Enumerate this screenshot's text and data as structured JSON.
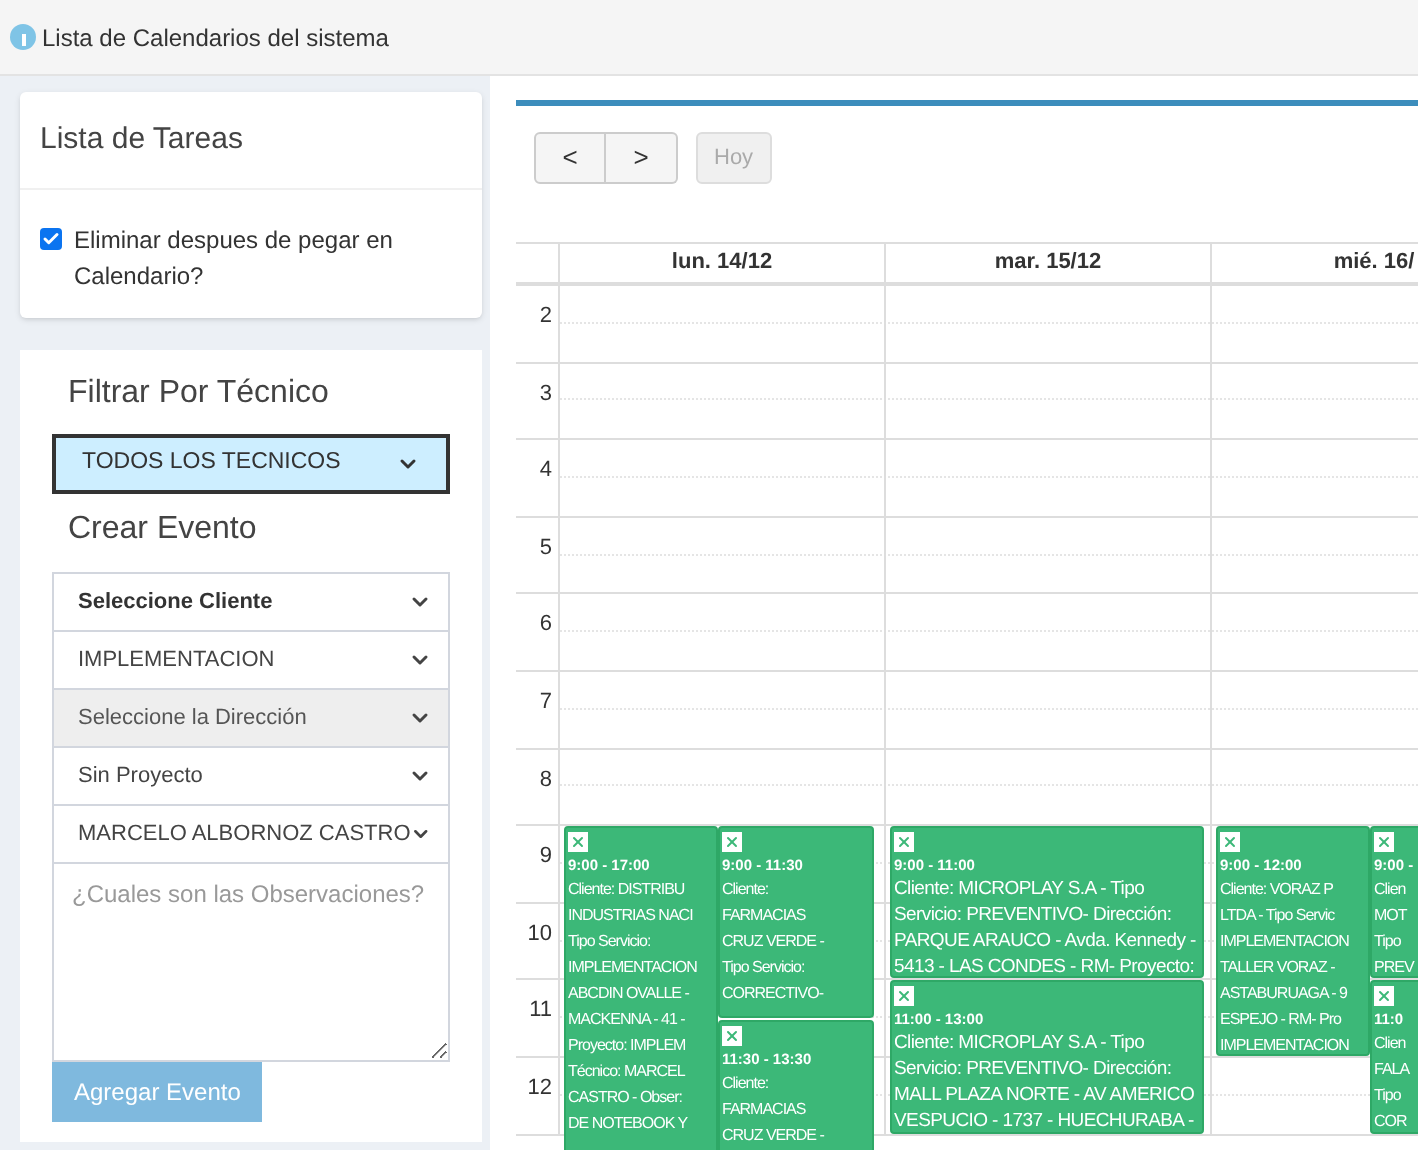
{
  "page_title": "Lista de Calendarios del sistema",
  "tasks": {
    "title": "Lista de Tareas",
    "remove_after_paste": {
      "label": "Eliminar despues de pegar en Calendario?",
      "checked": true
    }
  },
  "filter": {
    "title": "Filtrar Por Técnico",
    "value": "TODOS LOS TECNICOS"
  },
  "create_event": {
    "title": "Crear Evento",
    "selects": [
      {
        "value": "Seleccione Cliente",
        "kind": "bold"
      },
      {
        "value": "IMPLEMENTACION",
        "kind": "normal"
      },
      {
        "value": "Seleccione la Dirección",
        "kind": "disabled"
      },
      {
        "value": "Sin Proyecto",
        "kind": "normal"
      },
      {
        "value": "MARCELO ALBORNOZ CASTRO",
        "kind": "normal"
      }
    ],
    "observations": {
      "placeholder": "¿Cuales son las Observaciones?"
    },
    "submit": "Agregar Evento"
  },
  "calendar": {
    "prev": "<",
    "next": ">",
    "today": "Hoy",
    "days": [
      "lun. 14/12",
      "mar. 15/12",
      "mié. 16/"
    ],
    "hours": [
      "2",
      "3",
      "4",
      "5",
      "6",
      "7",
      "8",
      "9",
      "10",
      "11",
      "12"
    ],
    "events": [
      {
        "kind": "left",
        "time": "9:00 - 17:00",
        "lines": [
          "Cliente: DISTRIBU",
          "INDUSTRIAS NACI",
          "Tipo Servicio:",
          "IMPLEMENTACION",
          "ABCDIN OVALLE -",
          "MACKENNA - 41 -",
          "Proyecto: IMPLEM",
          "Técnico: MARCEL",
          "CASTRO - Obser:",
          "DE NOTEBOOK Y"
        ]
      },
      {
        "kind": "right",
        "time": "9:00 - 11:30",
        "lines": [
          "Cliente:",
          "FARMACIAS",
          "CRUZ VERDE -",
          "Tipo Servicio:",
          "CORRECTIVO-"
        ]
      },
      {
        "kind": "right",
        "time": "11:30 - 13:30",
        "lines": [
          "Cliente:",
          "FARMACIAS",
          "CRUZ VERDE -"
        ]
      },
      {
        "kind": "full",
        "time": "9:00 - 11:00",
        "lines": [
          "Cliente: MICROPLAY S.A - Tipo",
          "Servicio: PREVENTIVO- Dirección:",
          "PARQUE ARAUCO - Avda. Kennedy -",
          "5413 - LAS CONDES - RM- Proyecto:"
        ]
      },
      {
        "kind": "full",
        "time": "11:00 - 13:00",
        "lines": [
          "Cliente: MICROPLAY S.A - Tipo",
          "Servicio: PREVENTIVO- Dirección:",
          "MALL PLAZA NORTE - AV AMERICO",
          "VESPUCIO - 1737 - HUECHURABA -"
        ]
      },
      {
        "kind": "left",
        "time": "9:00 - 12:00",
        "lines": [
          "Cliente: VORAZ P",
          "LTDA - Tipo Servic",
          "IMPLEMENTACION",
          "TALLER VORAZ -",
          "ASTABURUAGA - 9",
          "ESPEJO - RM- Pro",
          "IMPLEMENTACION"
        ]
      },
      {
        "kind": "right",
        "time": "9:00 -",
        "lines": [
          "Clien",
          "MOT",
          "Tipo",
          "PREV"
        ]
      },
      {
        "kind": "right",
        "time": "11:0",
        "lines": [
          "Clien",
          "FALA",
          "Tipo",
          "COR"
        ]
      }
    ]
  }
}
